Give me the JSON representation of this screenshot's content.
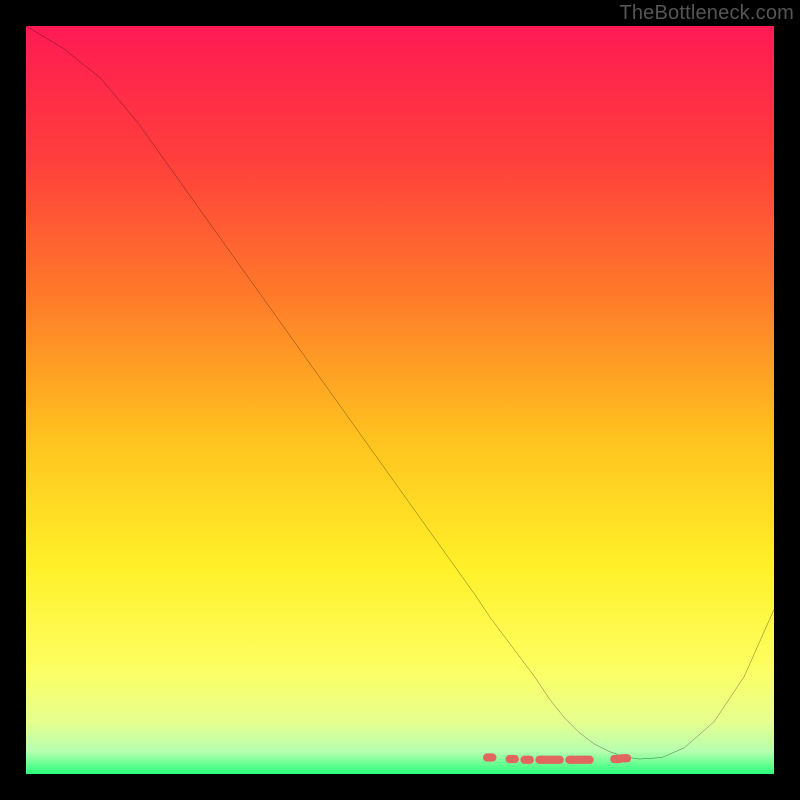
{
  "watermark": "TheBottleneck.com",
  "chart_data": {
    "type": "line",
    "title": "",
    "xlabel": "",
    "ylabel": "",
    "xlim": [
      0,
      100
    ],
    "ylim": [
      0,
      100
    ],
    "x": [
      0,
      5,
      10,
      15,
      20,
      25,
      30,
      35,
      40,
      45,
      50,
      55,
      60,
      62,
      65,
      68,
      70,
      72,
      74,
      76,
      78,
      80,
      82,
      85,
      88,
      92,
      96,
      100
    ],
    "values": [
      100,
      97,
      93,
      87,
      80,
      73,
      66,
      59,
      52,
      45,
      38,
      31,
      24,
      21,
      17,
      13,
      10,
      7.5,
      5.5,
      4,
      3,
      2.3,
      2,
      2.2,
      3.5,
      7,
      13,
      22
    ],
    "gradient_stops": [
      {
        "offset": 0.0,
        "color": "#ff1a54"
      },
      {
        "offset": 0.18,
        "color": "#ff3f3c"
      },
      {
        "offset": 0.36,
        "color": "#ff7a2a"
      },
      {
        "offset": 0.55,
        "color": "#ffc21f"
      },
      {
        "offset": 0.72,
        "color": "#fff028"
      },
      {
        "offset": 0.86,
        "color": "#fdff62"
      },
      {
        "offset": 0.93,
        "color": "#e6ff8f"
      },
      {
        "offset": 0.97,
        "color": "#b6ffb0"
      },
      {
        "offset": 1.0,
        "color": "#2aff7a"
      }
    ],
    "markers": {
      "color": "#e0665f",
      "x": [
        62,
        65,
        67,
        69,
        70,
        71,
        73,
        74,
        75,
        79,
        80
      ],
      "y": [
        2.2,
        2.0,
        1.9,
        1.9,
        1.9,
        1.9,
        1.9,
        1.9,
        1.9,
        2.0,
        2.1
      ]
    }
  }
}
